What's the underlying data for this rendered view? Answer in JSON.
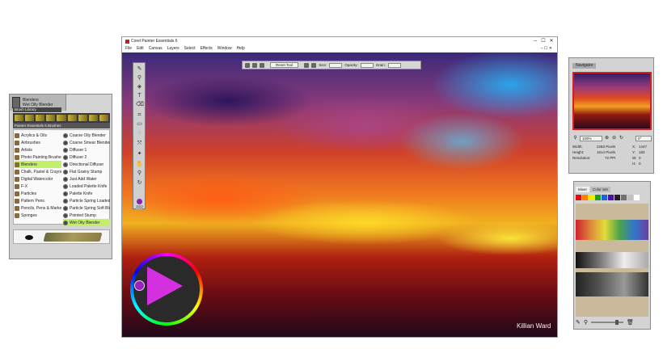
{
  "brushes": {
    "category_title": "Blenders",
    "variant_title": "Wet Oily Blender",
    "library_label": "Brush Library",
    "list_header": "Painter Essentials 6 Brushes",
    "categories": [
      "Acrylics & Oils",
      "Airbrushes",
      "Artists",
      "Photo Painting Brushes",
      "Blenders",
      "Chalk, Pastel & Crayons",
      "Digital Watercolor",
      "F-X",
      "Particles",
      "Pattern Pens",
      "Pencils, Pens & Markers",
      "Sponges"
    ],
    "selected_category_index": 4,
    "variants": [
      "Coarse Oily Blender",
      "Coarse Smear Blender 30m",
      "Diffuser 1",
      "Diffuser 2",
      "Directional Diffuser",
      "Flat Grainy Stump",
      "Just Add Water",
      "Loaded Palette Knife",
      "Palette Knife",
      "Particle Spring Loaded Knife",
      "Particle Spring Soft Blender",
      "Pointed Stump",
      "Wet Oily Blender"
    ],
    "selected_variant_index": 12
  },
  "window": {
    "title": "Corel Painter Essentials 6",
    "menu": [
      "File",
      "Edit",
      "Canvas",
      "Layers",
      "Select",
      "Effects",
      "Window",
      "Help"
    ],
    "controls": [
      "─",
      "☐",
      "✕"
    ],
    "menu_controls": "– ☐ ✕"
  },
  "property_bar": {
    "reset_label": "Reset Tool",
    "size_label": "Size:",
    "opacity_label": "Opacity:",
    "grain_label": "Grain:"
  },
  "canvas": {
    "watermark": "Killian Ward"
  },
  "navigator": {
    "tab_label": "Navigator",
    "zoom": "100%",
    "rotation": "0°",
    "width_label": "Width:",
    "width_value": "2283 Pixels",
    "height_label": "Height:",
    "height_value": "1614 Pixels",
    "resolution_label": "Resolution:",
    "resolution_value": "72 PPI",
    "x_label": "X:",
    "x_value": "1447",
    "y_label": "Y:",
    "y_value": "183",
    "w_label": "W:",
    "w_value": "0",
    "h_label": "H:",
    "h_value": "0"
  },
  "color_panel": {
    "tabs": [
      "Mixer",
      "Color Set"
    ],
    "active_tab_index": 0,
    "swatch_colors": [
      "#e01010",
      "#ff8000",
      "#f0f000",
      "#20a020",
      "#2060e0",
      "#5010a0",
      "#202020",
      "#707070",
      "#c0c0c0",
      "#ffffff"
    ]
  },
  "colors": {
    "accent_green": "#c3f06a",
    "main_color": "#8a20b8",
    "navigator_frame": "#d02020"
  }
}
